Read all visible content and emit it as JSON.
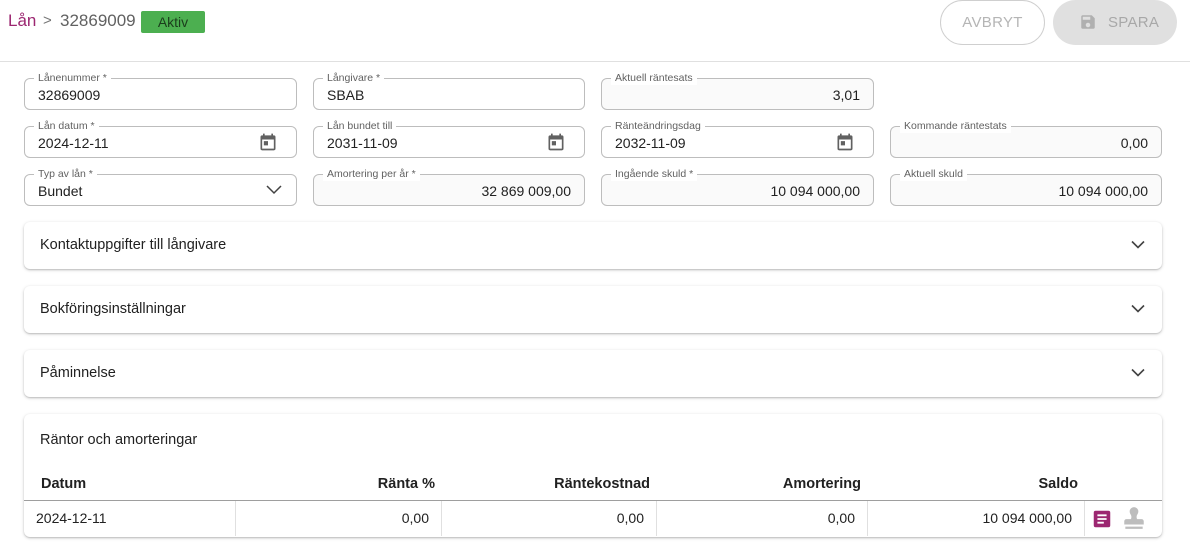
{
  "header": {
    "breadcrumb_link": "Lån",
    "breadcrumb_separator": ">",
    "breadcrumb_current": "32869009",
    "status_badge": "Aktiv",
    "cancel_label": "AVBRYT",
    "save_label": "SPARA"
  },
  "fields": {
    "loan_number": {
      "label": "Lånenummer *",
      "value": "32869009"
    },
    "lender": {
      "label": "Långivare *",
      "value": "SBAB"
    },
    "current_rate": {
      "label": "Aktuell räntesats",
      "value": "3,01"
    },
    "loan_date": {
      "label": "Lån datum *",
      "value": "2024-12-11"
    },
    "bound_until": {
      "label": "Lån bundet till",
      "value": "2031-11-09"
    },
    "rate_change_day": {
      "label": "Ränteändringsdag",
      "value": "2032-11-09"
    },
    "upcoming_rate": {
      "label": "Kommande räntestats",
      "value": "0,00"
    },
    "loan_type": {
      "label": "Typ av lån *",
      "value": "Bundet"
    },
    "amortization_per_year": {
      "label": "Amortering per år *",
      "value": "32 869 009,00"
    },
    "opening_debt": {
      "label": "Ingående skuld *",
      "value": "10 094 000,00"
    },
    "current_debt": {
      "label": "Aktuell skuld",
      "value": "10 094 000,00"
    }
  },
  "panels": {
    "contact": "Kontaktuppgifter till långivare",
    "accounting": "Bokföringsinställningar",
    "reminder": "Påminnelse"
  },
  "table": {
    "title": "Räntor och amorteringar",
    "columns": [
      "Datum",
      "Ränta %",
      "Räntekostnad",
      "Amortering",
      "Saldo"
    ],
    "rows": [
      {
        "date": "2024-12-11",
        "rate": "0,00",
        "interest_cost": "0,00",
        "amortization": "0,00",
        "balance": "10 094 000,00"
      }
    ]
  },
  "colors": {
    "brand": "#9c2771",
    "badge": "#4caf50"
  },
  "icons": [
    "calendar-icon",
    "chevron-down-icon",
    "save-icon",
    "document-icon",
    "stamp-icon"
  ]
}
